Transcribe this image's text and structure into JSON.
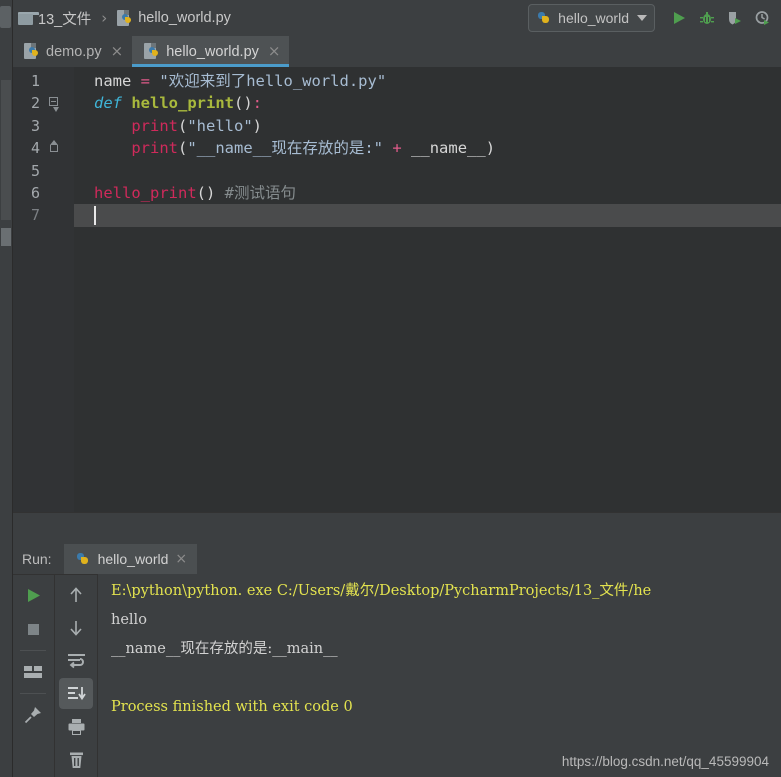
{
  "window": {
    "background": "#3c3f41",
    "editor_background": "#2f3132",
    "accent": "#4b9ccb"
  },
  "breadcrumb": {
    "folder_icon": "folder-icon",
    "folder": "13_文件",
    "separator": "›",
    "file_icon": "python-file-icon",
    "file": "hello_world.py"
  },
  "toolbar": {
    "run_config": {
      "icon": "python-icon",
      "label": "hello_world",
      "caret": "chevron-down-icon"
    },
    "buttons": [
      {
        "name": "run-button",
        "icon": "play-icon",
        "color": "#4f9e4f"
      },
      {
        "name": "debug-button",
        "icon": "bug-icon",
        "color": "#4f9e4f"
      },
      {
        "name": "run-with-coverage-button",
        "icon": "shield-play-icon",
        "color": "#9aa0a3"
      },
      {
        "name": "profile-button",
        "icon": "clock-play-icon",
        "color": "#9aa0a3"
      }
    ]
  },
  "editor_tabs": [
    {
      "label": "demo.py",
      "active": false,
      "close": "×",
      "icon": "python-file-icon"
    },
    {
      "label": "hello_world.py",
      "active": true,
      "close": "×",
      "icon": "python-file-icon"
    }
  ],
  "editor": {
    "line_numbers": [
      "1",
      "2",
      "3",
      "4",
      "5",
      "6",
      "7"
    ],
    "current_line": 7,
    "fold_markers": [
      {
        "line": 2,
        "type": "fold-open"
      },
      {
        "line": 4,
        "type": "fold-end"
      }
    ],
    "code": [
      {
        "line": 1,
        "tokens": [
          {
            "t": "name",
            "c": "plain"
          },
          {
            "t": " ",
            "c": "plain"
          },
          {
            "t": "=",
            "c": "op"
          },
          {
            "t": " ",
            "c": "plain"
          },
          {
            "t": "\"欢迎来到了hello_world.py\"",
            "c": "str"
          }
        ]
      },
      {
        "line": 2,
        "tokens": [
          {
            "t": "def",
            "c": "kw"
          },
          {
            "t": " ",
            "c": "plain"
          },
          {
            "t": "hello_print",
            "c": "fn"
          },
          {
            "t": "()",
            "c": "punct"
          },
          {
            "t": ":",
            "c": "op"
          }
        ]
      },
      {
        "line": 3,
        "tokens": [
          {
            "t": "    ",
            "c": "plain"
          },
          {
            "t": "print",
            "c": "fncall"
          },
          {
            "t": "(",
            "c": "punct"
          },
          {
            "t": "\"hello\"",
            "c": "str"
          },
          {
            "t": ")",
            "c": "punct"
          }
        ]
      },
      {
        "line": 4,
        "tokens": [
          {
            "t": "    ",
            "c": "plain"
          },
          {
            "t": "print",
            "c": "fncall"
          },
          {
            "t": "(",
            "c": "punct"
          },
          {
            "t": "\"__name__现在存放的是:\"",
            "c": "str"
          },
          {
            "t": " ",
            "c": "plain"
          },
          {
            "t": "+",
            "c": "op"
          },
          {
            "t": " ",
            "c": "plain"
          },
          {
            "t": "__name__",
            "c": "plain"
          },
          {
            "t": ")",
            "c": "punct"
          }
        ]
      },
      {
        "line": 5,
        "tokens": []
      },
      {
        "line": 6,
        "tokens": [
          {
            "t": "hello_print",
            "c": "fncall"
          },
          {
            "t": "()",
            "c": "punct"
          },
          {
            "t": " ",
            "c": "plain"
          },
          {
            "t": "#测试语句",
            "c": "cmt"
          }
        ]
      },
      {
        "line": 7,
        "tokens": []
      }
    ]
  },
  "run_panel": {
    "title": "Run:",
    "tab": {
      "label": "hello_world",
      "icon": "python-icon",
      "close": "×"
    },
    "left_buttons": [
      {
        "name": "rerun-button",
        "icon": "play-icon",
        "color": "#4f9e4f",
        "selected": false
      },
      {
        "name": "stop-button",
        "icon": "stop-icon",
        "color": "#848b8e",
        "selected": false
      },
      {
        "name": "layout-button",
        "icon": "layout-icon",
        "color": "#a9aeb0",
        "selected": false
      },
      {
        "name": "pin-tab-button",
        "icon": "pin-icon",
        "color": "#a9aeb0",
        "selected": false
      }
    ],
    "right_buttons": [
      {
        "name": "up-button",
        "icon": "arrow-up-icon",
        "color": "#a9aeb0",
        "selected": false
      },
      {
        "name": "down-button",
        "icon": "arrow-down-icon",
        "color": "#a9aeb0",
        "selected": false
      },
      {
        "name": "soft-wrap-button",
        "icon": "soft-wrap-icon",
        "color": "#a9aeb0",
        "selected": false
      },
      {
        "name": "scroll-to-end-button",
        "icon": "scroll-to-end-icon",
        "color": "#d0d4d6",
        "selected": true
      },
      {
        "name": "print-button",
        "icon": "printer-icon",
        "color": "#a9aeb0",
        "selected": false
      },
      {
        "name": "clear-all-button",
        "icon": "trash-icon",
        "color": "#a9aeb0",
        "selected": false
      }
    ],
    "console_lines": [
      {
        "text": "E:\\python\\python. exe C:/Users/戴尔/Desktop/PycharmProjects/13_文件/he",
        "color": "yellow"
      },
      {
        "text": "hello",
        "color": "white"
      },
      {
        "text": "__name__现在存放的是:__main__",
        "color": "white"
      },
      {
        "text": "",
        "color": "white"
      },
      {
        "text": "Process finished with exit code 0",
        "color": "yellow"
      }
    ]
  },
  "watermark": "https://blog.csdn.net/qq_45599904"
}
